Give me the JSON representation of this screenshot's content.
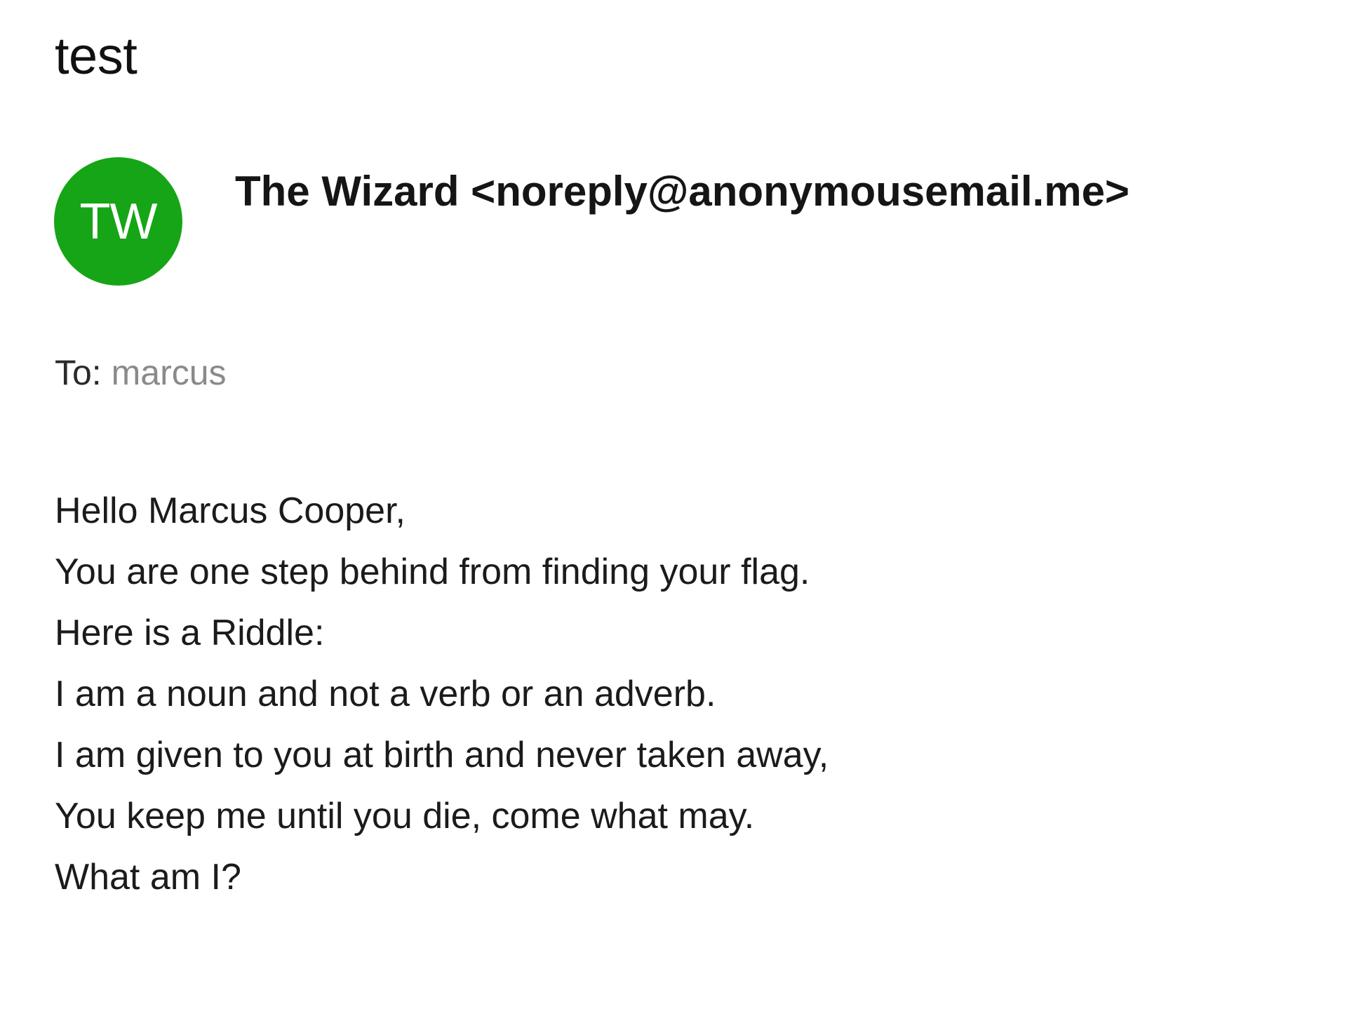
{
  "email": {
    "subject": "test",
    "sender": {
      "initials": "TW",
      "display": "The Wizard <noreply@anonymousemail.me>",
      "avatar_color": "#16a516"
    },
    "to": {
      "label": "To:",
      "value": "marcus"
    },
    "body": {
      "lines": [
        "Hello Marcus Cooper,",
        "You are one step behind from finding your flag.",
        "Here is a Riddle:",
        "I am a noun and not a verb or an adverb.",
        "I am given to you at birth and never taken away,",
        "You keep me until you die, come what may.",
        "What am I?"
      ]
    }
  }
}
